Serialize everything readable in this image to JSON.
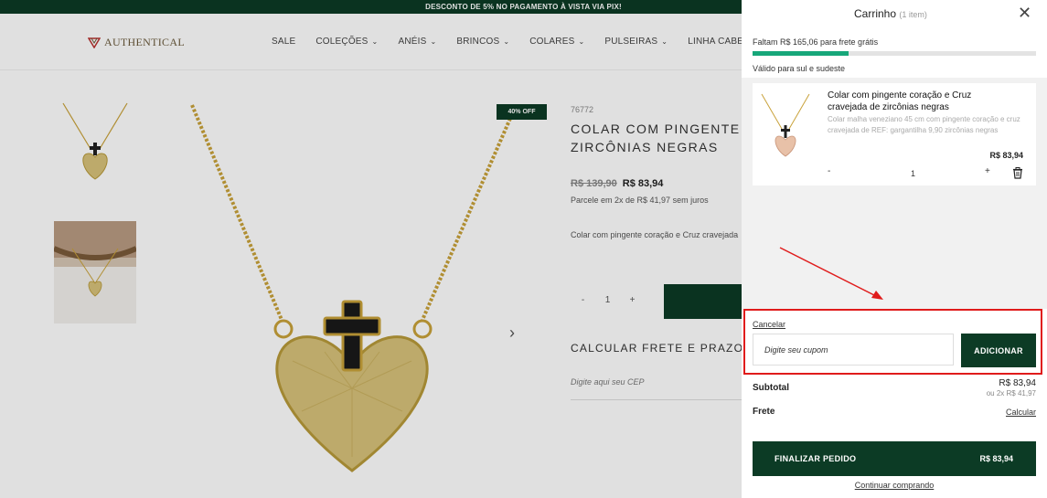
{
  "promo": {
    "text": "DESCONTO DE 5% NO PAGAMENTO À VISTA VIA PIX!"
  },
  "header": {
    "logo_text": "AUTHENTICAL",
    "nav": [
      {
        "label": "SALE",
        "has_dropdown": false
      },
      {
        "label": "COLEÇÕES",
        "has_dropdown": true
      },
      {
        "label": "ANÉIS",
        "has_dropdown": true
      },
      {
        "label": "BRINCOS",
        "has_dropdown": true
      },
      {
        "label": "COLARES",
        "has_dropdown": true
      },
      {
        "label": "PULSEIRAS",
        "has_dropdown": true
      },
      {
        "label": "LINHA CABELO",
        "has_dropdown": true
      }
    ]
  },
  "product": {
    "badge": "40% OFF",
    "sku": "76772",
    "title_line1": "COLAR COM PINGENTE",
    "title_line2": "ZIRCÔNIAS NEGRAS",
    "price_old": "R$ 139,90",
    "price_new": "R$ 83,94",
    "installments": "Parcele em 2x de R$ 41,97 sem juros",
    "description": "Colar com pingente coração e Cruz cravejada",
    "qty_minus": "-",
    "qty_value": "1",
    "qty_plus": "+",
    "shipping_title": "CALCULAR FRETE E PRAZO",
    "cep_placeholder": "Digite aqui seu CEP"
  },
  "cart": {
    "title": "Carrinho",
    "count": "(1 item)",
    "shipping_message": "Faltam R$ 165,06 para frete grátis",
    "shipping_progress": 0.34,
    "shipping_valid": "Válido para sul e sudeste",
    "item": {
      "name": "Colar com pingente coração e Cruz cravejada de zircônias negras",
      "description": "Colar malha veneziano 45 cm com pingente coração e cruz cravejada de REF: gargantilha 9,90 zircônias negras",
      "price": "R$ 83,94",
      "minus": "-",
      "qty": "1",
      "plus": "+"
    },
    "coupon": {
      "cancel": "Cancelar",
      "placeholder": "Digite seu cupom",
      "apply": "ADICIONAR"
    },
    "subtotal_label": "Subtotal",
    "subtotal_value": "R$ 83,94",
    "subtotal_installments": "ou 2x R$ 41,97",
    "frete_label": "Frete",
    "frete_link": "Calcular",
    "checkout_label": "FINALIZAR PEDIDO",
    "checkout_price": "R$ 83,94",
    "continue": "Continuar comprando"
  },
  "colors": {
    "brand_green": "#0c3b25",
    "progress_green": "#17a77a",
    "annotation_red": "#e01b1b"
  }
}
